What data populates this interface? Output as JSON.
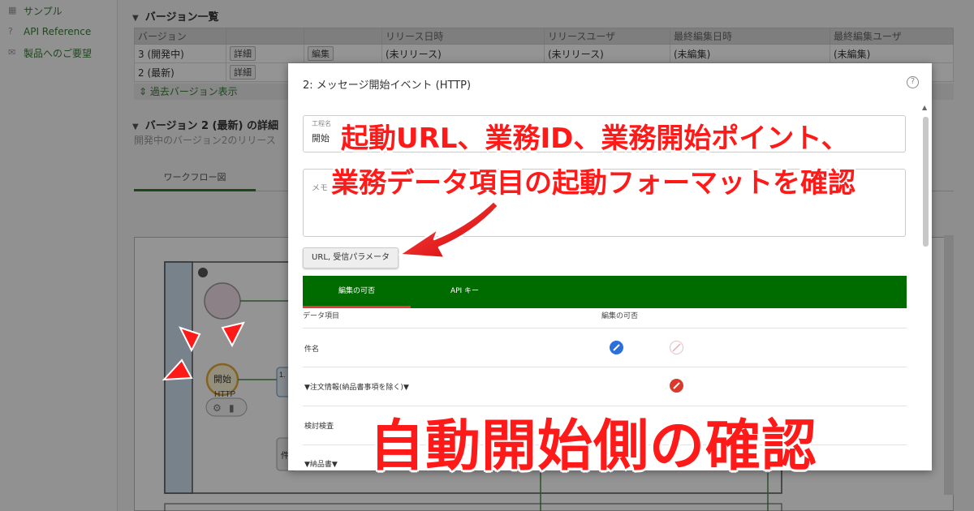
{
  "sidebar": {
    "items": [
      {
        "label": "サンプル",
        "icon": "sample-icon"
      },
      {
        "label": "API Reference",
        "icon": "help-icon"
      },
      {
        "label": "製品へのご要望",
        "icon": "feedback-icon"
      }
    ]
  },
  "versions": {
    "heading": "バージョン一覧",
    "columns": [
      "バージョン",
      "",
      "",
      "リリース日時",
      "リリースユーザ",
      "最終編集日時",
      "最終編集ユーザ"
    ],
    "rows": [
      {
        "version": "3 (開発中)",
        "detail": "詳細",
        "edit": "編集",
        "release_date": "(未リリース)",
        "release_user": "(未リリース)",
        "edit_date": "(未編集)",
        "edit_user": "(未編集)"
      },
      {
        "version": "2 (最新)",
        "detail": "詳細"
      }
    ],
    "past_versions": "過去バージョン表示"
  },
  "detail": {
    "heading": "バージョン 2 (最新) の詳細",
    "note": "開発中のバージョン2のリリース",
    "tab": "ワークフロー図"
  },
  "diagram": {
    "start_label": "開始",
    "start_sub": "HTTP",
    "task_label": "1.",
    "task2_label": "件"
  },
  "modal": {
    "title": "2: メッセージ開始イベント (HTTP)",
    "name_label": "工程名",
    "name_value": "開始",
    "memo_label": "メモ",
    "url_button": "URL, 受信パラメータ",
    "tabs": [
      "編集の可否",
      "API キー"
    ],
    "col_item": "データ項目",
    "col_edit": "編集の可否",
    "rows": [
      "件名",
      "▼注文情報(納品書事項を除く)▼",
      "検討検査",
      "▼納品書▼"
    ]
  },
  "annotations": {
    "line1": "起動URL、業務ID、業務開始ポイント、",
    "line2": "業務データ項目の起動フォーマットを確認",
    "main": "自動開始側の確認"
  },
  "colors": {
    "accent_green": "#006c00",
    "annotation_red": "#ff1a1a",
    "edit_blue": "#2a6fdb"
  }
}
